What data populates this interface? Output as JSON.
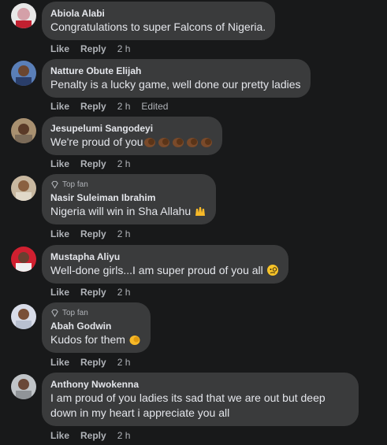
{
  "comments": [
    {
      "name": "Abiola Alabi",
      "text": "Congratulations to super Falcons of Nigeria.",
      "like": "Like",
      "reply": "Reply",
      "time": "2 h"
    },
    {
      "name": "Natture Obute Elijah",
      "text": "Penalty is a lucky game, well done our pretty ladies",
      "like": "Like",
      "reply": "Reply",
      "time": "2 h",
      "edited": "Edited"
    },
    {
      "name": "Jesupelumi Sangodeyi",
      "text": "We're proud of you",
      "like": "Like",
      "reply": "Reply",
      "time": "2 h",
      "emoji": "clapping-hands-x5"
    },
    {
      "badge": "Top fan",
      "name": "Nasir Suleiman Ibrahim",
      "text": "Nigeria will win in Sha Allahu ",
      "like": "Like",
      "reply": "Reply",
      "time": "2 h",
      "emoji": "raised-hands"
    },
    {
      "name": "Mustapha Aliyu",
      "text": "Well-done girls...I am super proud of you all ",
      "like": "Like",
      "reply": "Reply",
      "time": "2 h",
      "emoji": "face-with-monocle"
    },
    {
      "badge": "Top fan",
      "name": "Abah Godwin",
      "text": "Kudos for them ",
      "like": "Like",
      "reply": "Reply",
      "time": "2 h",
      "emoji": "clapping-hands"
    },
    {
      "name": "Anthony Nwokenna",
      "text": "I am proud of you ladies its sad that we are out but deep down in my heart i appreciate you all",
      "like": "Like",
      "reply": "Reply",
      "time": "2 h"
    }
  ],
  "colors": {
    "background": "#18191a",
    "bubble": "#3a3b3c",
    "text": "#e4e6eb",
    "secondary": "#b0b3b8"
  }
}
